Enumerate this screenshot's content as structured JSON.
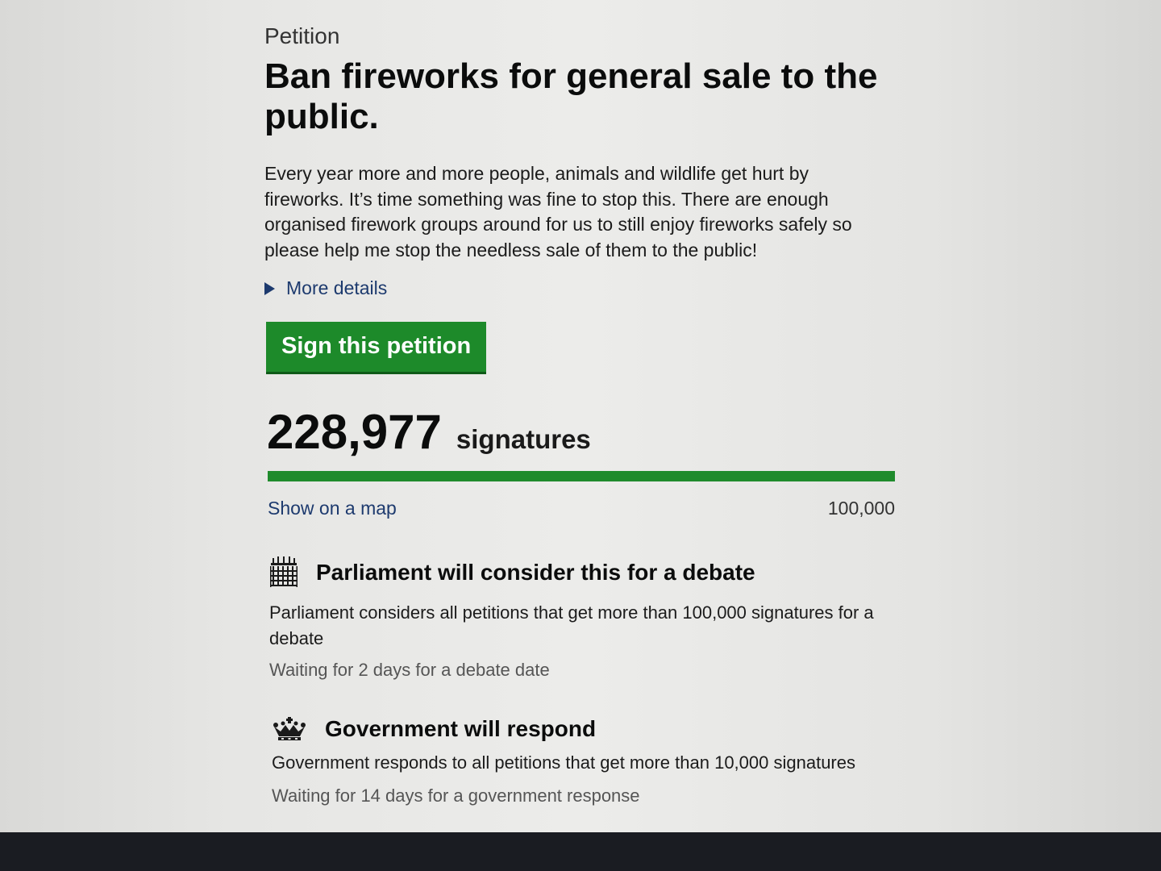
{
  "petition": {
    "caption": "Petition",
    "title": "Ban fireworks for general sale to the public.",
    "summary": "Every year more and more people, animals and wildlife get hurt by fireworks. It’s time something was fine to stop this. There are enough organised firework groups around for us to still enjoy fireworks safely so please help me stop the needless sale of them to the public!",
    "more_details_label": "More details",
    "sign_button_label": "Sign this petition"
  },
  "signatures": {
    "count": "228,977",
    "label": "signatures",
    "show_on_map_label": "Show on a map",
    "threshold_label": "100,000",
    "progress_fraction": 1.0,
    "progress_color": "#1f8b2c"
  },
  "debate": {
    "icon": "portcullis-icon",
    "title": "Parliament will consider this for a debate",
    "body": "Parliament considers all petitions that get more than 100,000 signatures for a debate",
    "status": "Waiting for 2 days for a debate date"
  },
  "government": {
    "icon": "crown-icon",
    "title": "Government will respond",
    "body": "Government responds to all petitions that get more than 10,000 signatures",
    "status": "Waiting for 14 days for a government response"
  },
  "colors": {
    "sign_button": "#1d8a2a",
    "link": "#1d3a6e"
  }
}
